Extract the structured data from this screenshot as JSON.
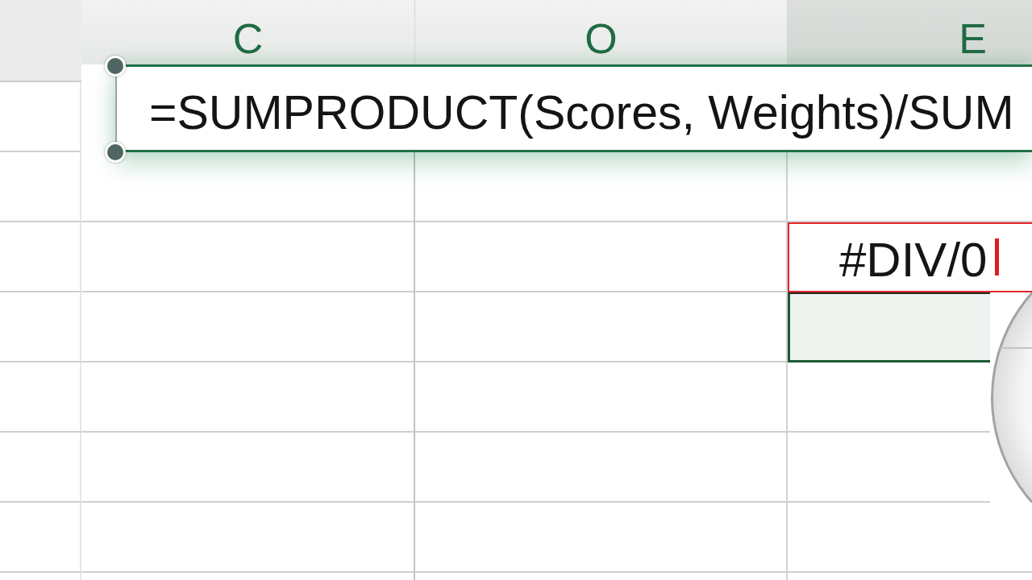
{
  "column_headers": [
    {
      "label": "C",
      "selected": false
    },
    {
      "label": "O",
      "selected": false
    },
    {
      "label": "E",
      "selected": true
    }
  ],
  "formula_bar": {
    "value": "=SUMPRODUCT(Scores, Weights)/SUM"
  },
  "rows": [
    {
      "cells": [
        {
          "selected": false,
          "error": false,
          "editing": false
        },
        {
          "selected": false,
          "error": false,
          "editing": false
        },
        {
          "selected": false,
          "error": false,
          "editing": false
        }
      ]
    },
    {
      "cells": [
        {
          "selected": false,
          "error": false,
          "editing": false
        },
        {
          "selected": false,
          "error": false,
          "editing": false
        },
        {
          "selected": false,
          "error": true,
          "editing": true,
          "value": "#DIV/0"
        }
      ]
    },
    {
      "cells": [
        {
          "selected": false,
          "error": false,
          "editing": false
        },
        {
          "selected": false,
          "error": false,
          "editing": false
        },
        {
          "selected": true,
          "error": false,
          "editing": false
        }
      ]
    },
    {
      "cells": [
        {
          "selected": false,
          "error": false,
          "editing": false
        },
        {
          "selected": false,
          "error": false,
          "editing": false
        },
        {
          "selected": false,
          "error": false,
          "editing": false
        }
      ]
    },
    {
      "cells": [
        {
          "selected": false,
          "error": false,
          "editing": false
        },
        {
          "selected": false,
          "error": false,
          "editing": false
        },
        {
          "selected": false,
          "error": false,
          "editing": false
        }
      ]
    },
    {
      "cells": [
        {
          "selected": false,
          "error": false,
          "editing": false
        },
        {
          "selected": false,
          "error": false,
          "editing": false
        },
        {
          "selected": false,
          "error": false,
          "editing": false
        }
      ]
    }
  ]
}
